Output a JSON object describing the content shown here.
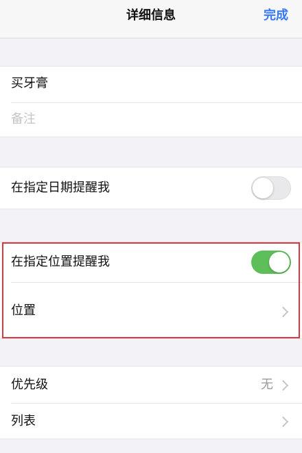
{
  "nav": {
    "title": "详细信息",
    "done_label": "完成"
  },
  "task": {
    "title": "买牙膏",
    "notes_placeholder": "备注"
  },
  "date_reminder": {
    "label": "在指定日期提醒我",
    "enabled": false
  },
  "location_reminder": {
    "label": "在指定位置提醒我",
    "enabled": true,
    "location_label": "位置"
  },
  "priority": {
    "label": "优先级",
    "value": "无"
  },
  "list": {
    "label": "列表"
  },
  "colors": {
    "accent": "#3478f6",
    "switch_on": "#5ebe5a",
    "highlight": "#d9363e"
  },
  "icons": {
    "disclosure": "chevron-right-icon"
  }
}
